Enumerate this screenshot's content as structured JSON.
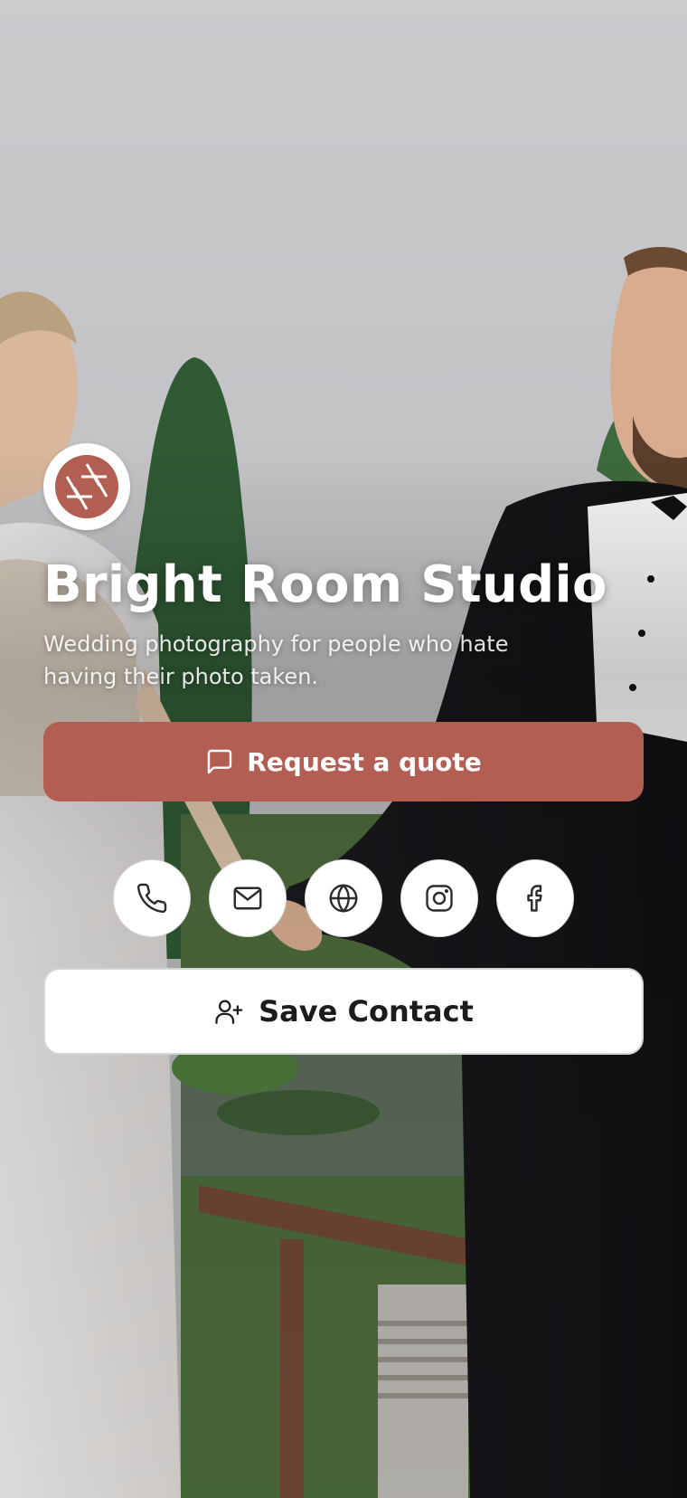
{
  "profile": {
    "name": "Bright Room Studio",
    "tagline": "Wedding photography for people who hate having their photo taken.",
    "logo_icon": "camera-aperture-icon"
  },
  "actions": {
    "quote_label": "Request a quote",
    "quote_icon": "message-square-icon",
    "save_label": "Save Contact",
    "save_icon": "user-plus-icon"
  },
  "contact_links": [
    {
      "icon": "phone-icon"
    },
    {
      "icon": "mail-icon"
    },
    {
      "icon": "globe-icon"
    },
    {
      "icon": "instagram-icon"
    },
    {
      "icon": "facebook-icon"
    }
  ],
  "colors": {
    "accent": "#b35e52",
    "button_text": "#ffffff",
    "save_bg": "#ffffff",
    "icon_stroke": "#2b2b2b"
  }
}
